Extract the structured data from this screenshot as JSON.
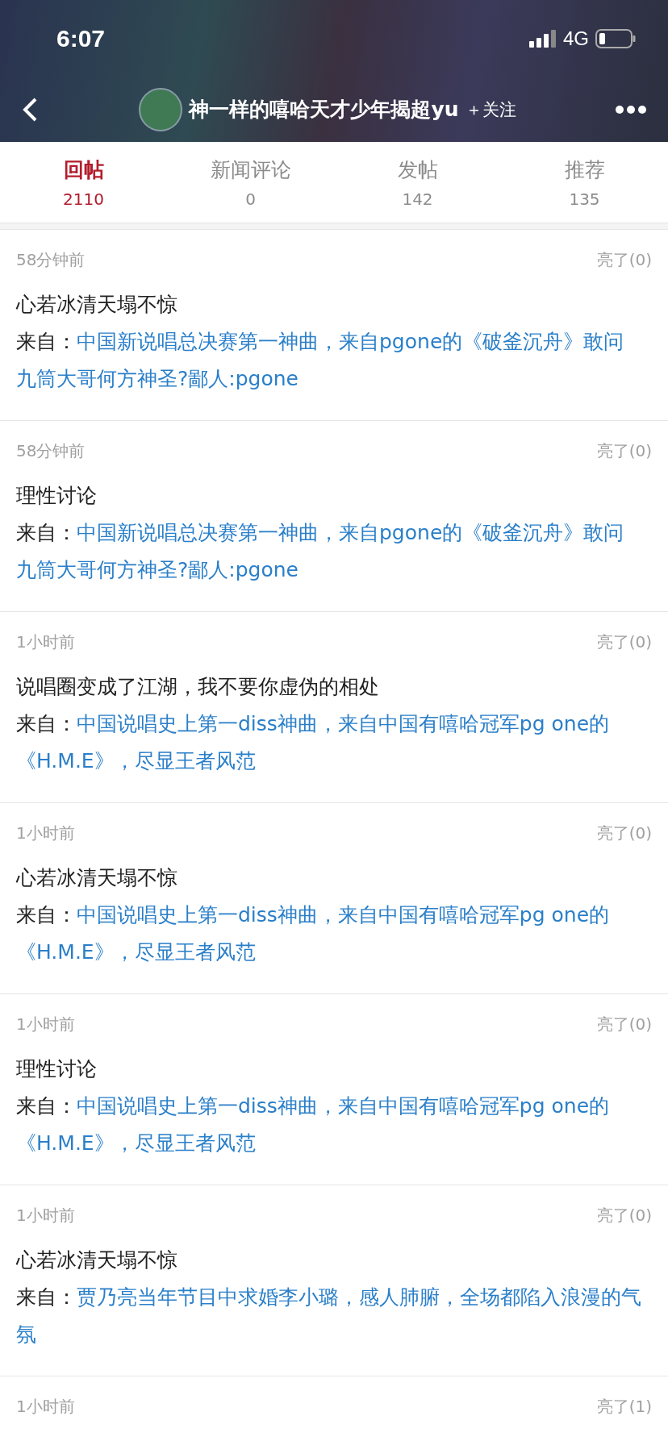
{
  "status_bar": {
    "time": "6:07",
    "network": "4G"
  },
  "nav": {
    "title": "神一样的嘻哈天才少年揭超yu",
    "follow": "＋关注"
  },
  "tabs": [
    {
      "label": "回帖",
      "count": "2110",
      "selected": true
    },
    {
      "label": "新闻评论",
      "count": "0",
      "selected": false
    },
    {
      "label": "发帖",
      "count": "142",
      "selected": false
    },
    {
      "label": "推荐",
      "count": "135",
      "selected": false
    }
  ],
  "posts": [
    {
      "time": "58分钟前",
      "likes": "亮了(0)",
      "content": "心若冰清天塌不惊",
      "source_label": "来自：",
      "source": "中国新说唱总决赛第一神曲，来自pgone的《破釜沉舟》敢问九筒大哥何方神圣?鄙人:pgone"
    },
    {
      "time": "58分钟前",
      "likes": "亮了(0)",
      "content": "理性讨论",
      "source_label": "来自：",
      "source": "中国新说唱总决赛第一神曲，来自pgone的《破釜沉舟》敢问九筒大哥何方神圣?鄙人:pgone"
    },
    {
      "time": "1小时前",
      "likes": "亮了(0)",
      "content": "说唱圈变成了江湖，我不要你虚伪的相处",
      "source_label": "来自：",
      "source": "中国说唱史上第一diss神曲，来自中国有嘻哈冠军pg one的《H.M.E》，尽显王者风范"
    },
    {
      "time": "1小时前",
      "likes": "亮了(0)",
      "content": "心若冰清天塌不惊",
      "source_label": "来自：",
      "source": "中国说唱史上第一diss神曲，来自中国有嘻哈冠军pg one的《H.M.E》，尽显王者风范"
    },
    {
      "time": "1小时前",
      "likes": "亮了(0)",
      "content": "理性讨论",
      "source_label": "来自：",
      "source": "中国说唱史上第一diss神曲，来自中国有嘻哈冠军pg one的《H.M.E》，尽显王者风范"
    },
    {
      "time": "1小时前",
      "likes": "亮了(0)",
      "content": "心若冰清天塌不惊",
      "source_label": "来自：",
      "source": "贾乃亮当年节目中求婚李小璐，感人肺腑，全场都陷入浪漫的气氛"
    },
    {
      "time": "1小时前",
      "likes": "亮了(1)"
    }
  ]
}
